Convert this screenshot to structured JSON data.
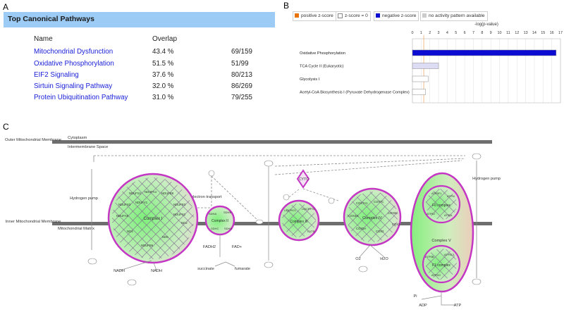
{
  "panels": {
    "a": "A",
    "b": "B",
    "c": "C"
  },
  "table": {
    "title": "Top Canonical Pathways",
    "col_name": "Name",
    "col_overlap": "Overlap",
    "rows": [
      {
        "name": "Mitochondrial Dysfunction",
        "pct": "43.4 %",
        "frac": "69/159"
      },
      {
        "name": "Oxidative Phosphorylation",
        "pct": "51.5 %",
        "frac": "51/99"
      },
      {
        "name": "EIF2 Signaling",
        "pct": "37.6 %",
        "frac": "80/213"
      },
      {
        "name": "Sirtuin Signaling Pathway",
        "pct": "32.0 %",
        "frac": "86/269"
      },
      {
        "name": "Protein Ubiquitination Pathway",
        "pct": "31.0 %",
        "frac": "79/255"
      }
    ]
  },
  "legend": [
    {
      "label": "positive z-score",
      "color": "#e8730c"
    },
    {
      "label": "z-score = 0",
      "color": "#ffffff"
    },
    {
      "label": "negative z-score",
      "color": "#0b0bd2"
    },
    {
      "label": "no activity pattern available",
      "color": "#cccccc"
    }
  ],
  "chart_data": {
    "type": "bar",
    "orientation": "horizontal",
    "xlabel": "-log(p-value)",
    "xlim": [
      0,
      17
    ],
    "xticks": [
      0,
      1,
      2,
      3,
      4,
      5,
      6,
      7,
      8,
      9,
      10,
      11,
      12,
      13,
      14,
      15,
      16,
      17
    ],
    "threshold": 1.3,
    "categories": [
      "Oxidative Phosphorylation",
      "TCA Cycle II (Eukaryotic)",
      "Glycolysis I",
      "Acetyl-CoA Biosynthesis I (Pyruvate Dehydrogenase Complex)"
    ],
    "values": [
      16.5,
      3.0,
      1.8,
      1.5
    ],
    "colors": [
      "#0b0bd2",
      "#dcdcf4",
      "#ffffff",
      "#ffffff"
    ]
  },
  "diagram": {
    "outer_membrane": "Outer Mitochondrial\nMembrane",
    "cytoplasm": "Cytoplasm",
    "intermembrane": "Intermembrane\nSpace",
    "inner_membrane": "Inner Mitochondrial\nMembrane",
    "matrix": "Mitochondrial\nMatrix",
    "hydrogen_pump_left": "Hydrogen\npump",
    "hydrogen_pump_right": "Hydrogen pump",
    "electron_transport": "electron transport",
    "complex_i": "Complex\nI",
    "complex_ii": "Complex\nII",
    "complex_iii": "Complex\nIII",
    "complex_iv": "Complex\nIV",
    "complex_v": "Complex V",
    "f0_complex": "F0 complex",
    "f1_complex": "F1 complex",
    "cytc": "CYTC",
    "nadh": "NADH",
    "fadh2": "FADH2",
    "fad": "FAD+",
    "succinate": "succinate",
    "fumarate": "fumarate",
    "o2": "O2",
    "h2o": "H2O",
    "h_plus": "H+",
    "pi": "Pi",
    "adp": "ADP",
    "atp": "ATP",
    "e_minus": "e-",
    "ci_genes": [
      "NDUFS1",
      "NDUFA4",
      "NDUFB8",
      "NDUFS3",
      "NDUFV1",
      "NDUFB3",
      "NDUFA9",
      "NDUFS2",
      "ND2",
      "ND4",
      "ND5",
      "NDUFB6"
    ],
    "cii_genes": [
      "SDHA",
      "SDHB",
      "SDHC",
      "SDHD"
    ],
    "ciii_genes": [
      "UQCRC1",
      "UQCRFS1",
      "CYTB"
    ],
    "civ_genes": [
      "COX7A1",
      "COX7C",
      "COX4I1",
      "COX6C",
      "COX5A",
      "COX2",
      "COX3"
    ],
    "f0_genes": [
      "ATP5F1",
      "ATP5I",
      "ATP5J",
      "ATP5L"
    ],
    "f1_genes": [
      "ATP5B",
      "ATP5C1",
      "ATP5O"
    ]
  }
}
